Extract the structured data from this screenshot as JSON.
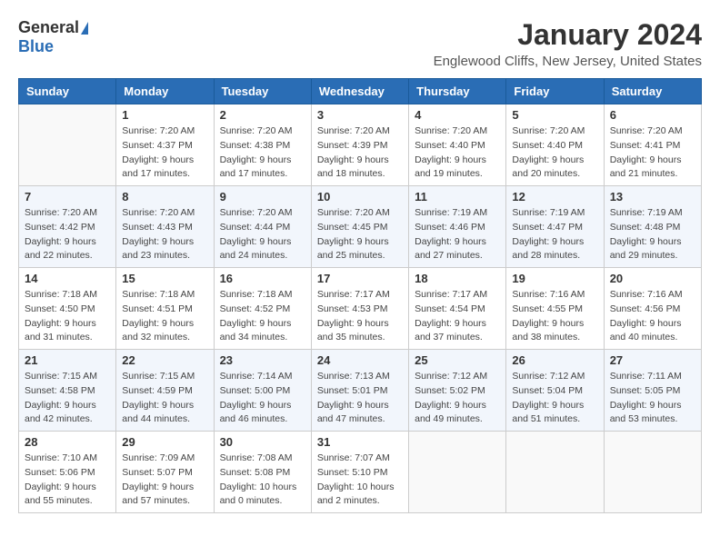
{
  "header": {
    "logo_general": "General",
    "logo_blue": "Blue",
    "title": "January 2024",
    "subtitle": "Englewood Cliffs, New Jersey, United States"
  },
  "days_of_week": [
    "Sunday",
    "Monday",
    "Tuesday",
    "Wednesday",
    "Thursday",
    "Friday",
    "Saturday"
  ],
  "weeks": [
    [
      {
        "day": "",
        "info": ""
      },
      {
        "day": "1",
        "info": "Sunrise: 7:20 AM\nSunset: 4:37 PM\nDaylight: 9 hours\nand 17 minutes."
      },
      {
        "day": "2",
        "info": "Sunrise: 7:20 AM\nSunset: 4:38 PM\nDaylight: 9 hours\nand 17 minutes."
      },
      {
        "day": "3",
        "info": "Sunrise: 7:20 AM\nSunset: 4:39 PM\nDaylight: 9 hours\nand 18 minutes."
      },
      {
        "day": "4",
        "info": "Sunrise: 7:20 AM\nSunset: 4:40 PM\nDaylight: 9 hours\nand 19 minutes."
      },
      {
        "day": "5",
        "info": "Sunrise: 7:20 AM\nSunset: 4:40 PM\nDaylight: 9 hours\nand 20 minutes."
      },
      {
        "day": "6",
        "info": "Sunrise: 7:20 AM\nSunset: 4:41 PM\nDaylight: 9 hours\nand 21 minutes."
      }
    ],
    [
      {
        "day": "7",
        "info": ""
      },
      {
        "day": "8",
        "info": "Sunrise: 7:20 AM\nSunset: 4:43 PM\nDaylight: 9 hours\nand 23 minutes."
      },
      {
        "day": "9",
        "info": "Sunrise: 7:20 AM\nSunset: 4:44 PM\nDaylight: 9 hours\nand 24 minutes."
      },
      {
        "day": "10",
        "info": "Sunrise: 7:20 AM\nSunset: 4:45 PM\nDaylight: 9 hours\nand 25 minutes."
      },
      {
        "day": "11",
        "info": "Sunrise: 7:19 AM\nSunset: 4:46 PM\nDaylight: 9 hours\nand 27 minutes."
      },
      {
        "day": "12",
        "info": "Sunrise: 7:19 AM\nSunset: 4:47 PM\nDaylight: 9 hours\nand 28 minutes."
      },
      {
        "day": "13",
        "info": "Sunrise: 7:19 AM\nSunset: 4:48 PM\nDaylight: 9 hours\nand 29 minutes."
      }
    ],
    [
      {
        "day": "14",
        "info": "Sunrise: 7:18 AM\nSunset: 4:50 PM\nDaylight: 9 hours\nand 31 minutes."
      },
      {
        "day": "15",
        "info": "Sunrise: 7:18 AM\nSunset: 4:51 PM\nDaylight: 9 hours\nand 32 minutes."
      },
      {
        "day": "16",
        "info": "Sunrise: 7:18 AM\nSunset: 4:52 PM\nDaylight: 9 hours\nand 34 minutes."
      },
      {
        "day": "17",
        "info": "Sunrise: 7:17 AM\nSunset: 4:53 PM\nDaylight: 9 hours\nand 35 minutes."
      },
      {
        "day": "18",
        "info": "Sunrise: 7:17 AM\nSunset: 4:54 PM\nDaylight: 9 hours\nand 37 minutes."
      },
      {
        "day": "19",
        "info": "Sunrise: 7:16 AM\nSunset: 4:55 PM\nDaylight: 9 hours\nand 38 minutes."
      },
      {
        "day": "20",
        "info": "Sunrise: 7:16 AM\nSunset: 4:56 PM\nDaylight: 9 hours\nand 40 minutes."
      }
    ],
    [
      {
        "day": "21",
        "info": "Sunrise: 7:15 AM\nSunset: 4:58 PM\nDaylight: 9 hours\nand 42 minutes."
      },
      {
        "day": "22",
        "info": "Sunrise: 7:15 AM\nSunset: 4:59 PM\nDaylight: 9 hours\nand 44 minutes."
      },
      {
        "day": "23",
        "info": "Sunrise: 7:14 AM\nSunset: 5:00 PM\nDaylight: 9 hours\nand 46 minutes."
      },
      {
        "day": "24",
        "info": "Sunrise: 7:13 AM\nSunset: 5:01 PM\nDaylight: 9 hours\nand 47 minutes."
      },
      {
        "day": "25",
        "info": "Sunrise: 7:12 AM\nSunset: 5:02 PM\nDaylight: 9 hours\nand 49 minutes."
      },
      {
        "day": "26",
        "info": "Sunrise: 7:12 AM\nSunset: 5:04 PM\nDaylight: 9 hours\nand 51 minutes."
      },
      {
        "day": "27",
        "info": "Sunrise: 7:11 AM\nSunset: 5:05 PM\nDaylight: 9 hours\nand 53 minutes."
      }
    ],
    [
      {
        "day": "28",
        "info": "Sunrise: 7:10 AM\nSunset: 5:06 PM\nDaylight: 9 hours\nand 55 minutes."
      },
      {
        "day": "29",
        "info": "Sunrise: 7:09 AM\nSunset: 5:07 PM\nDaylight: 9 hours\nand 57 minutes."
      },
      {
        "day": "30",
        "info": "Sunrise: 7:08 AM\nSunset: 5:08 PM\nDaylight: 10 hours\nand 0 minutes."
      },
      {
        "day": "31",
        "info": "Sunrise: 7:07 AM\nSunset: 5:10 PM\nDaylight: 10 hours\nand 2 minutes."
      },
      {
        "day": "",
        "info": ""
      },
      {
        "day": "",
        "info": ""
      },
      {
        "day": "",
        "info": ""
      }
    ]
  ]
}
